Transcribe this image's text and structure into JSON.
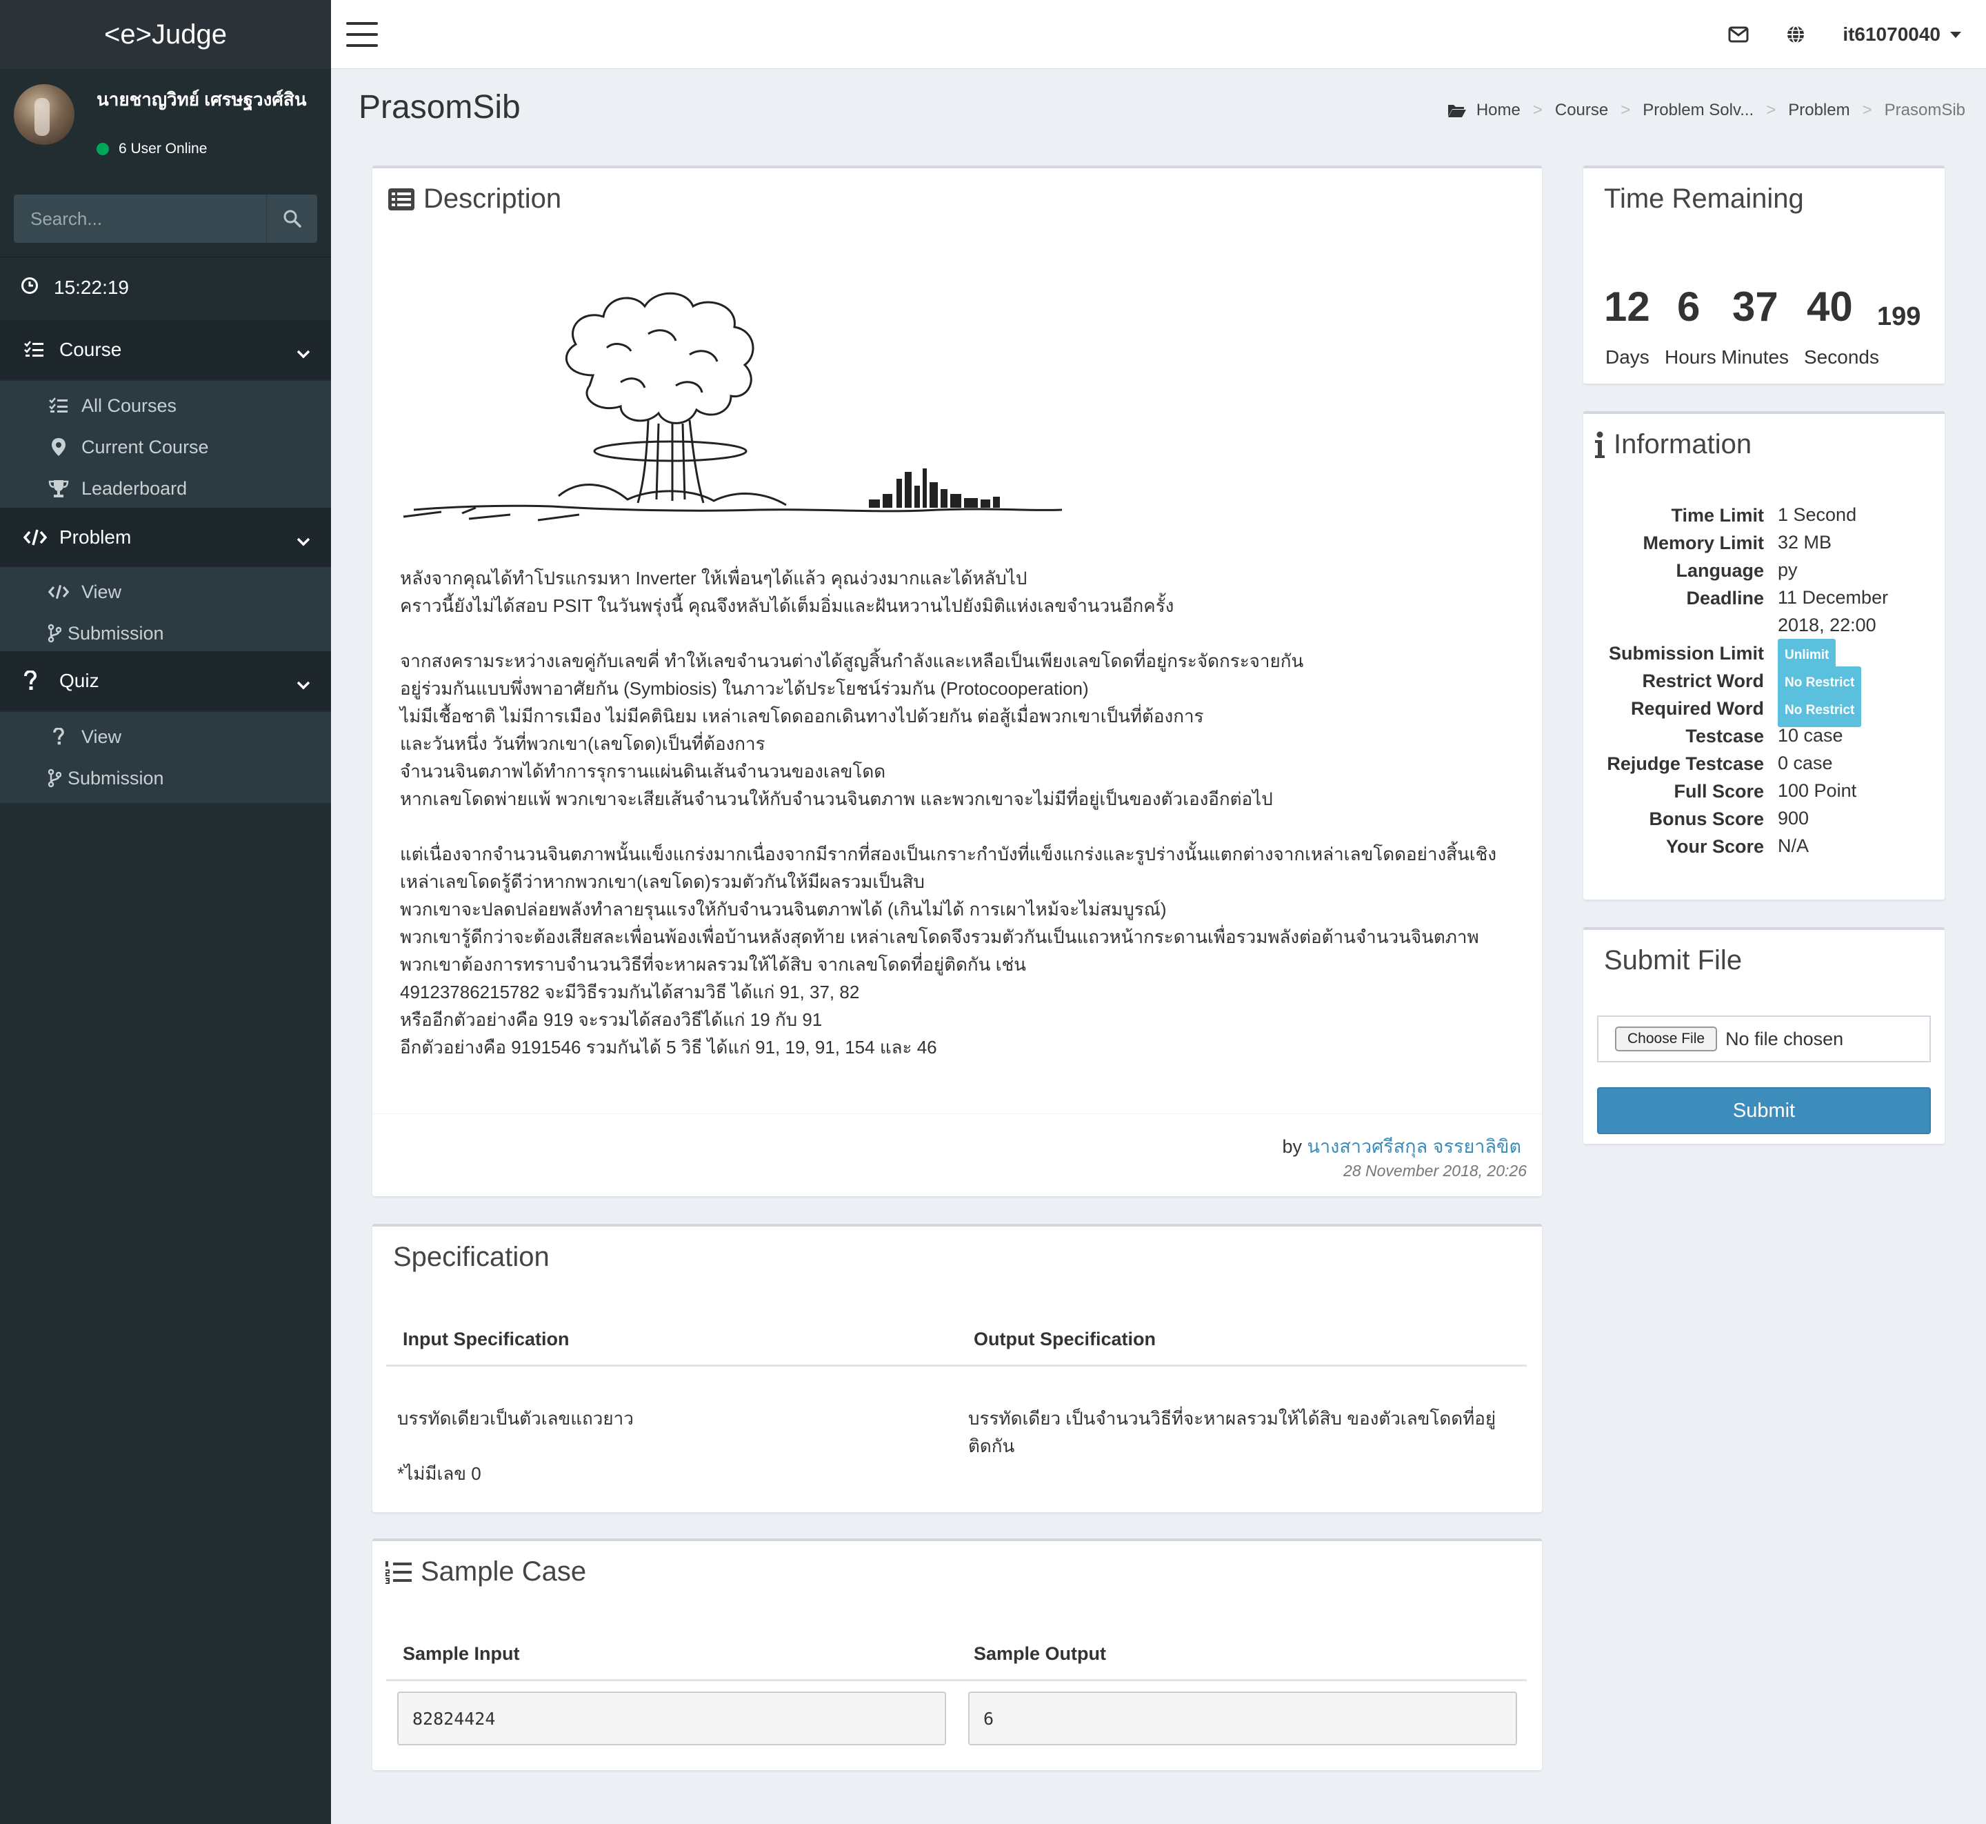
{
  "app": {
    "brand": "<e>Judge"
  },
  "user": {
    "name": "นายชาญวิทย์ เศรษฐวงศ์สิน",
    "online_text": "6 User Online",
    "username": "it61070040"
  },
  "search": {
    "placeholder": "Search..."
  },
  "clock": "15:22:19",
  "sidebar": {
    "sections": [
      {
        "label": "Course",
        "items": [
          {
            "label": "All Courses",
            "icon": "list-icon"
          },
          {
            "label": "Current Course",
            "icon": "map-marker-icon"
          },
          {
            "label": "Leaderboard",
            "icon": "trophy-icon"
          }
        ]
      },
      {
        "label": "Problem",
        "items": [
          {
            "label": "View",
            "icon": "code-icon"
          },
          {
            "label": "Submission",
            "icon": "branch-icon"
          }
        ]
      },
      {
        "label": "Quiz",
        "items": [
          {
            "label": "View",
            "icon": "question-icon"
          },
          {
            "label": "Submission",
            "icon": "branch-icon"
          }
        ]
      }
    ]
  },
  "page": {
    "title": "PrasomSib"
  },
  "breadcrumb": [
    "Home",
    "Course",
    "Problem Solv...",
    "Problem",
    "PrasomSib"
  ],
  "description": {
    "title": "Description",
    "paragraphs": [
      [
        "หลังจากคุณได้ทำโปรแกรมหา Inverter ให้เพื่อนๆได้แล้ว คุณง่วงมากและได้หลับไป",
        "คราวนี้ยังไม่ได้สอบ PSIT ในวันพรุ่งนี้ คุณจึงหลับได้เต็มอิ่มและฝันหวานไปยังมิติแห่งเลขจำนวนอีกครั้ง"
      ],
      [
        "จากสงครามระหว่างเลขคู่กับเลขคี่ ทำให้เลขจำนวนต่างได้สูญสิ้นกำลังและเหลือเป็นเพียงเลขโดดที่อยู่กระจัดกระจายกัน",
        "อยู่ร่วมกันแบบพึ่งพาอาศัยกัน (Symbiosis) ในภาวะได้ประโยชน์ร่วมกัน (Protocooperation)",
        "ไม่มีเชื้อชาติ ไม่มีการเมือง ไม่มีคตินิยม เหล่าเลขโดดออกเดินทางไปด้วยกัน ต่อสู้เมื่อพวกเขาเป็นที่ต้องการ",
        "และวันหนึ่ง วันที่พวกเขา(เลขโดด)เป็นที่ต้องการ",
        "จำนวนจินตภาพได้ทำการรุกรานแผ่นดินเส้นจำนวนของเลขโดด",
        "หากเลขโดดพ่ายแพ้ พวกเขาจะเสียเส้นจำนวนให้กับจำนวนจินตภาพ และพวกเขาจะไม่มีที่อยู่เป็นของตัวเองอีกต่อไป"
      ],
      [
        "แต่เนื่องจากจำนวนจินตภาพนั้นแข็งแกร่งมากเนื่องจากมีรากที่สองเป็นเกราะกำบังที่แข็งแกร่งและรูปร่างนั้นแตกต่างจากเหล่าเลขโดดอย่างสิ้นเชิง",
        "เหล่าเลขโดดรู้ดีว่าหากพวกเขา(เลขโดด)รวมตัวกันให้มีผลรวมเป็นสิบ",
        "พวกเขาจะปลดปล่อยพลังทำลายรุนแรงให้กับจำนวนจินตภาพได้ (เกินไม่ได้ การเผาไหม้จะไม่สมบูรณ์)",
        "พวกเขารู้ดีกว่าจะต้องเสียสละเพื่อนพ้องเพื่อบ้านหลังสุดท้าย เหล่าเลขโดดจึงรวมตัวกันเป็นแถวหน้ากระดานเพื่อรวมพลังต่อต้านจำนวนจินตภาพ",
        "พวกเขาต้องการทราบจำนวนวิธีที่จะหาผลรวมให้ได้สิบ จากเลขโดดที่อยู่ติดกัน เช่น",
        "49123786215782 จะมีวิธีรวมกันได้สามวิธี ได้แก่ 91, 37, 82",
        "หรืออีกตัวอย่างคือ 919 จะรวมได้สองวิธีได้แก่ 19 กับ 91",
        "อีกตัวอย่างคือ 9191546 รวมกันได้ 5 วิธี ได้แก่ 91, 19, 91, 154 และ 46"
      ]
    ],
    "by_prefix": "by",
    "author": "นางสาวศรีสกุล จรรยาลิขิต",
    "date": "28 November 2018, 20:26"
  },
  "specification": {
    "title": "Specification",
    "input_header": "Input Specification",
    "output_header": "Output Specification",
    "input_lines": [
      "บรรทัดเดียวเป็นตัวเลขแถวยาว",
      "*ไม่มีเลข 0"
    ],
    "output_lines": [
      "บรรทัดเดียว เป็นจำนวนวิธีที่จะหาผลรวมให้ได้สิบ ของตัวเลขโดดที่อยู่",
      "ติดกัน"
    ]
  },
  "sample": {
    "title": "Sample Case",
    "input_header": "Sample Input",
    "output_header": "Sample Output",
    "input": "82824424",
    "output": "6"
  },
  "time_remaining": {
    "title": "Time Remaining",
    "days": "12",
    "hours": "6",
    "minutes": "37",
    "seconds": "40",
    "ms": "199",
    "labels": {
      "days": "Days",
      "hours": "Hours",
      "minutes": "Minutes",
      "seconds": "Seconds"
    }
  },
  "information": {
    "title": "Information",
    "time_limit": {
      "key": "Time Limit",
      "value": "1 Second"
    },
    "memory_limit": {
      "key": "Memory Limit",
      "value": "32 MB"
    },
    "language": {
      "key": "Language",
      "value": "py"
    },
    "deadline": {
      "key": "Deadline",
      "value_line1": "11 December",
      "value_line2": "2018, 22:00"
    },
    "submission_limit": {
      "key": "Submission Limit",
      "value": "Unlimit"
    },
    "restrict_word": {
      "key": "Restrict Word",
      "value": "No Restrict"
    },
    "required_word": {
      "key": "Required Word",
      "value": "No Restrict"
    },
    "testcase": {
      "key": "Testcase",
      "value": "10 case"
    },
    "rejudge_testcase": {
      "key": "Rejudge Testcase",
      "value": "0 case"
    },
    "full_score": {
      "key": "Full Score",
      "value": "100 Point"
    },
    "bonus_score": {
      "key": "Bonus Score",
      "value": "900"
    },
    "your_score": {
      "key": "Your Score",
      "value": "N/A"
    }
  },
  "submit_file": {
    "title": "Submit File",
    "choose_label": "Choose File",
    "no_file": "No file chosen",
    "submit_label": "Submit"
  },
  "colors": {
    "sidebar_bg": "#222d32",
    "primary": "#3c8dbc",
    "badge": "#5bc0de",
    "online": "#00a65a"
  }
}
